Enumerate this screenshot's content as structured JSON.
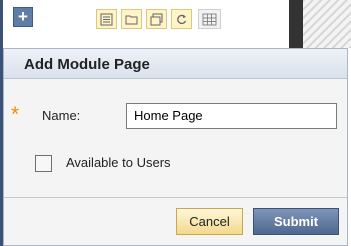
{
  "toolbar": {
    "add_symbol": "+",
    "tools": [
      {
        "icon": "list-icon"
      },
      {
        "icon": "folder-icon"
      },
      {
        "icon": "window-icon"
      },
      {
        "icon": "refresh-icon"
      },
      {
        "icon": "grid-icon"
      }
    ]
  },
  "dialog": {
    "title": "Add Module Page",
    "required_marker": "*",
    "name_label": "Name:",
    "name_value": "Home Page",
    "available_label": "Available to Users",
    "available_checked": false,
    "cancel_label": "Cancel",
    "submit_label": "Submit"
  },
  "colors": {
    "accent": "#5f7ea5",
    "required": "#f28b00",
    "submit": "#4f6890"
  }
}
